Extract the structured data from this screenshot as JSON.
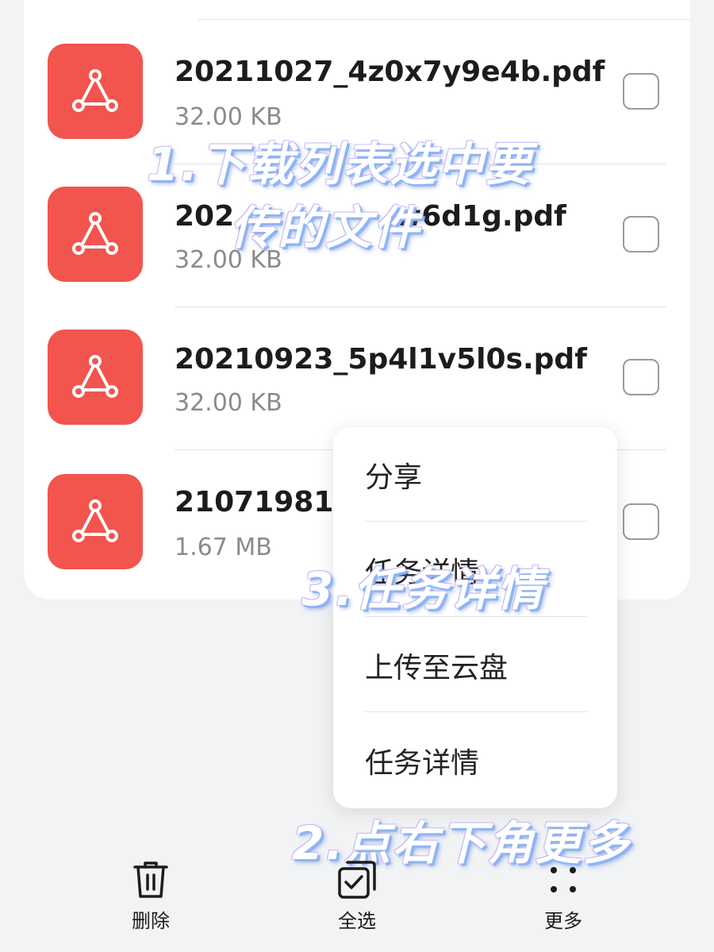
{
  "files": [
    {
      "name": "20211027_4z0x7y9e4b.pdf",
      "size": "32.00 KB",
      "checked": false
    },
    {
      "name": "202",
      "name_tail": "w6d1g.pdf",
      "size": "32.00 KB",
      "checked": false
    },
    {
      "name": "20210923_5p4l1v5l0s.pdf",
      "size": "32.00 KB",
      "checked": false
    },
    {
      "name": "210719816",
      "size": "1.67 MB",
      "checked": false
    }
  ],
  "menu": {
    "items": [
      "分享",
      "任务详情",
      "上传至云盘",
      "任务详情"
    ]
  },
  "annotations": {
    "step1_line1": "1.下载列表选中要",
    "step1_line2": "传的文件",
    "step2": "2.点右下角更多",
    "step3": "3.任务详情"
  },
  "toolbar": {
    "delete_label": "删除",
    "select_all_label": "全选",
    "more_label": "更多"
  },
  "colors": {
    "pdf_icon": "#f2544e",
    "background": "#f1f3f5",
    "annotation_shadow": "#8fb4f2"
  }
}
